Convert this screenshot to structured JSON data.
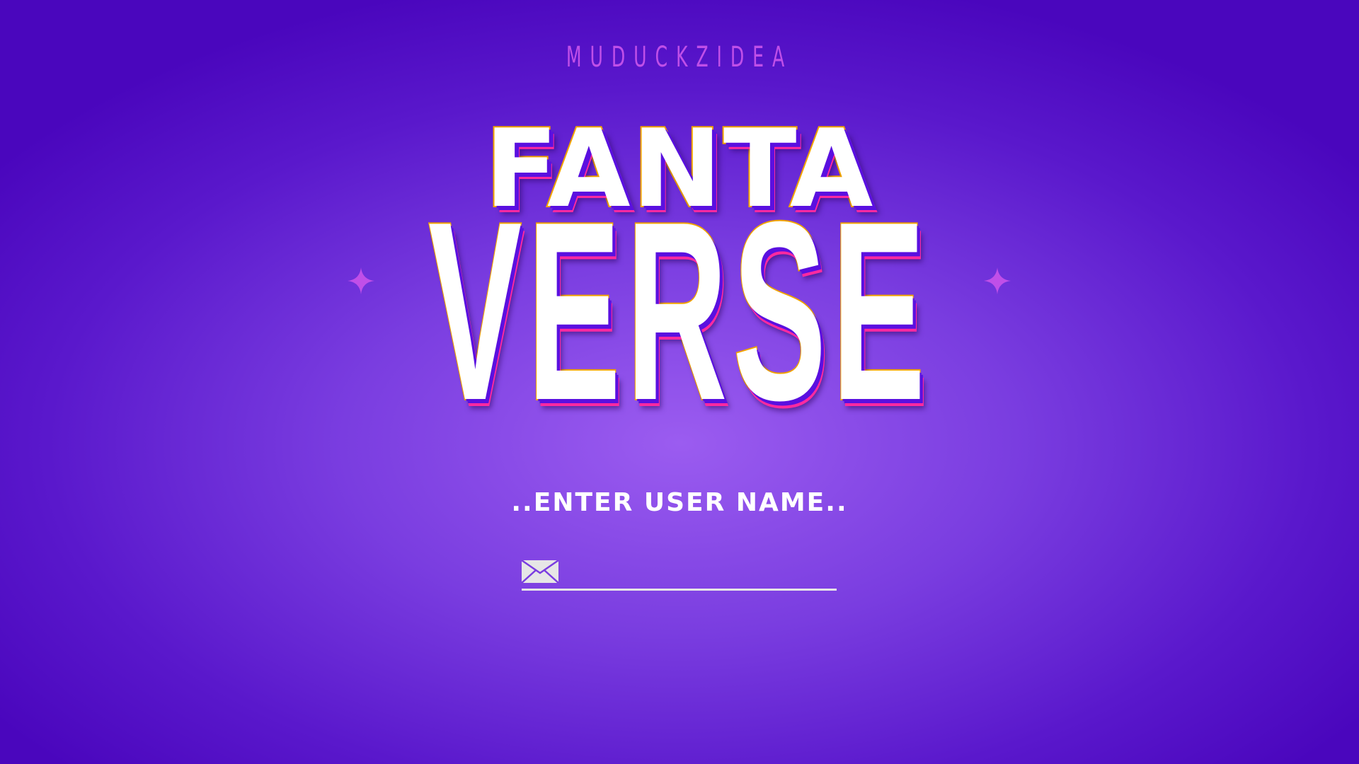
{
  "brand": "MUDUCKZIDEA",
  "title": {
    "line1": "FANTA",
    "line2": "VERSE"
  },
  "login": {
    "label": "..ENTER USER NAME..",
    "username_value": "",
    "username_placeholder": ""
  },
  "icons": {
    "sparkle": "sparkle-icon",
    "envelope": "envelope-icon"
  },
  "colors": {
    "accent": "#c04fe8",
    "stroke": "#f2a400",
    "shadow": "#ff2aa0"
  }
}
